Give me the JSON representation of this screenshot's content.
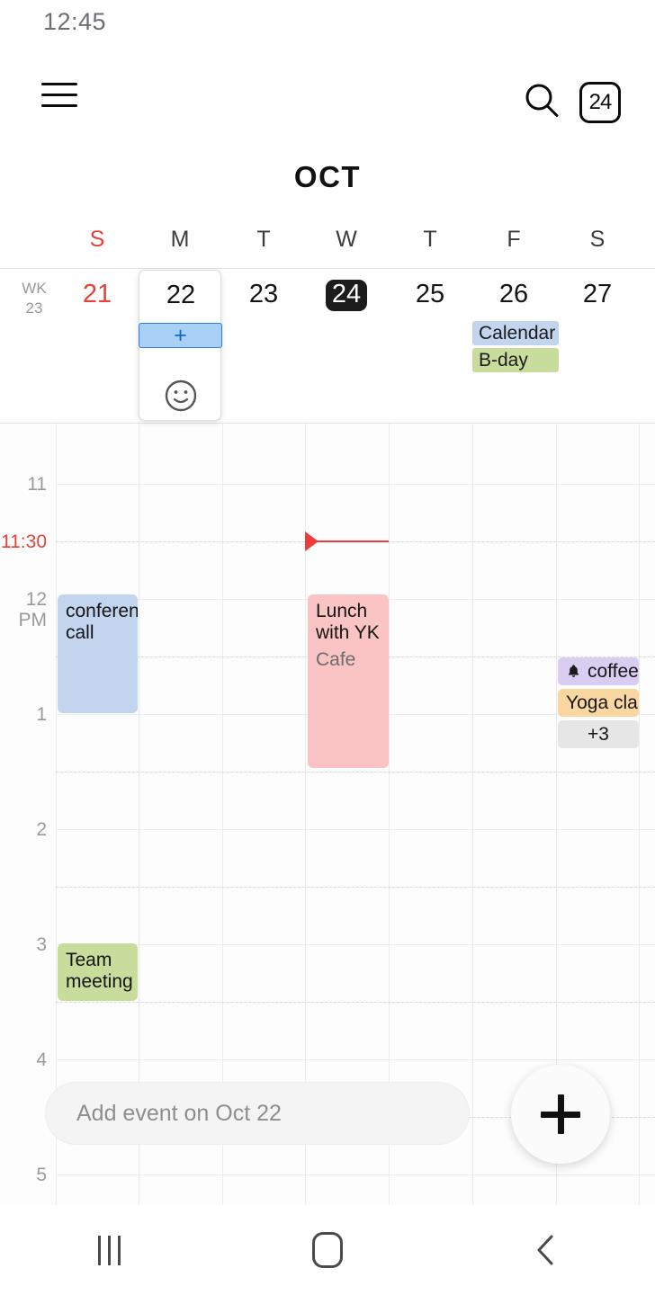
{
  "status": {
    "time": "12:45"
  },
  "appbar": {
    "menu_icon": "hamburger-icon",
    "search_icon": "search-icon",
    "today_icon_label": "24"
  },
  "header": {
    "month": "OCT"
  },
  "week": {
    "week_label_line1": "WK",
    "week_label_line2": "23",
    "weekdays": [
      {
        "label": "S",
        "weekend": true
      },
      {
        "label": "M",
        "weekend": false
      },
      {
        "label": "T",
        "weekend": false
      },
      {
        "label": "W",
        "weekend": false
      },
      {
        "label": "T",
        "weekend": false
      },
      {
        "label": "F",
        "weekend": false
      },
      {
        "label": "S",
        "weekend": false
      }
    ],
    "days": [
      {
        "num": "21",
        "weekend": true,
        "today": false,
        "selected": false
      },
      {
        "num": "22",
        "weekend": false,
        "today": false,
        "selected": true
      },
      {
        "num": "23",
        "weekend": false,
        "today": false,
        "selected": false
      },
      {
        "num": "24",
        "weekend": false,
        "today": true,
        "selected": false
      },
      {
        "num": "25",
        "weekend": false,
        "today": false,
        "selected": false
      },
      {
        "num": "26",
        "weekend": false,
        "today": false,
        "selected": false
      },
      {
        "num": "27",
        "weekend": false,
        "today": false,
        "selected": false
      }
    ],
    "allday_events": [
      {
        "title": "Calendar",
        "day": 5,
        "color": "#c3d4ef"
      },
      {
        "title": "B-day",
        "day": 5,
        "color": "#c8dc9c"
      }
    ],
    "selected_day_card": {
      "day_number": "22",
      "add_label": "+",
      "sticker_icon": "smiley-icon"
    }
  },
  "timegrid": {
    "time_labels": [
      {
        "text": "11",
        "sub": "",
        "now": false
      },
      {
        "text": "11:30",
        "sub": "",
        "now": true
      },
      {
        "text": "12",
        "sub": "PM",
        "now": false
      },
      {
        "text": "1",
        "sub": "",
        "now": false
      },
      {
        "text": "2",
        "sub": "",
        "now": false
      },
      {
        "text": "3",
        "sub": "",
        "now": false
      },
      {
        "text": "4",
        "sub": "",
        "now": false
      },
      {
        "text": "5",
        "sub": "",
        "now": false
      }
    ],
    "current_time_marker": {
      "time": "11:30",
      "day": 3,
      "color": "#ef3b3b"
    },
    "events": [
      {
        "title": "conference call",
        "location": "",
        "day": 0,
        "color": "#c3d4ef"
      },
      {
        "title": "Lunch with YK",
        "location": "Cafe",
        "day": 3,
        "color": "#fac4c4"
      },
      {
        "title": "Team meeting",
        "location": "",
        "day": 0,
        "color": "#c8dc9c"
      }
    ],
    "overflow_chips": [
      {
        "title": "coffee",
        "icon": "bell-icon",
        "color": "#d9cdf2"
      },
      {
        "title": "Yoga cla",
        "icon": "",
        "color": "#fad7a0"
      },
      {
        "title": "+3",
        "icon": "",
        "color": "#e6e6e6"
      }
    ]
  },
  "compose": {
    "placeholder": "Add event on Oct 22",
    "fab_label": "add-event"
  },
  "navbar": {
    "recents": "recents-icon",
    "home": "home-icon",
    "back": "back-icon"
  }
}
